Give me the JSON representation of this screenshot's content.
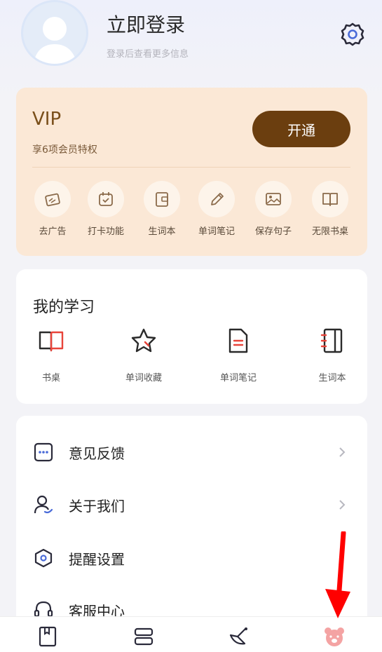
{
  "header": {
    "login_title": "立即登录",
    "login_subtitle": "登录后查看更多信息"
  },
  "vip": {
    "title": "VIP",
    "subtitle": "享6项会员特权",
    "open_button": "开通",
    "accent_color": "#6b3e0f",
    "perks": [
      {
        "label": "去广告",
        "icon": "ad-remove-icon"
      },
      {
        "label": "打卡功能",
        "icon": "calendar-check-icon"
      },
      {
        "label": "生词本",
        "icon": "wallet-book-icon"
      },
      {
        "label": "单词笔记",
        "icon": "pencil-icon"
      },
      {
        "label": "保存句子",
        "icon": "image-icon"
      },
      {
        "label": "无限书桌",
        "icon": "open-book-icon"
      }
    ]
  },
  "study": {
    "title": "我的学习",
    "items": [
      {
        "label": "书桌",
        "icon": "book-icon"
      },
      {
        "label": "单词收藏",
        "icon": "star-icon"
      },
      {
        "label": "单词笔记",
        "icon": "note-icon"
      },
      {
        "label": "生词本",
        "icon": "notebook-icon"
      }
    ]
  },
  "menu": {
    "items": [
      {
        "label": "意见反馈",
        "icon": "feedback-icon"
      },
      {
        "label": "关于我们",
        "icon": "user-icon"
      },
      {
        "label": "提醒设置",
        "icon": "hexagon-settings-icon"
      },
      {
        "label": "客服中心",
        "icon": "headset-icon"
      }
    ]
  },
  "bottom_nav": [
    {
      "icon": "bookshelf-icon"
    },
    {
      "icon": "library-icon"
    },
    {
      "icon": "discover-icon"
    },
    {
      "icon": "profile-bear-icon",
      "active": true
    }
  ],
  "annotation_color": "#ff0000"
}
